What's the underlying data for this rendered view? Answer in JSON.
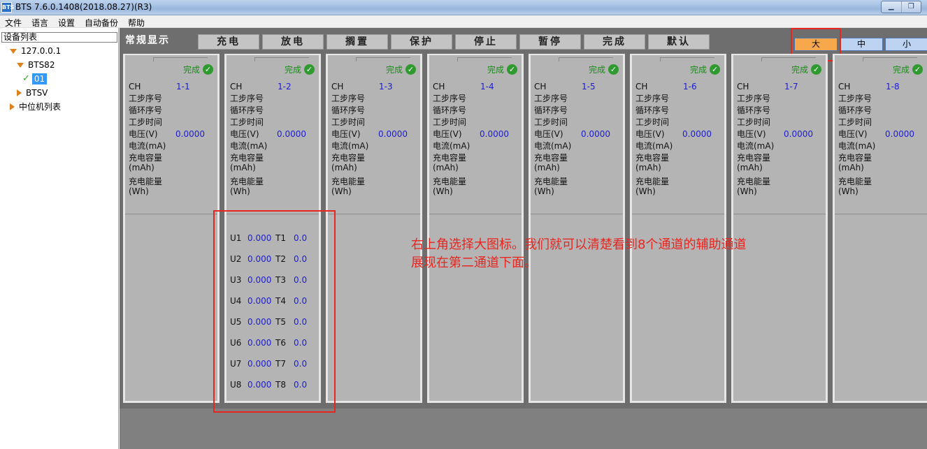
{
  "window": {
    "title": "BTS 7.6.0.1408(2018.08.27)(R3)",
    "icon_text": "BTS"
  },
  "menu": [
    "文件",
    "语言",
    "设置",
    "自动备份",
    "帮助"
  ],
  "sidebar": {
    "header": "设备列表",
    "tree": [
      {
        "label": "127.0.0.1",
        "expanded": true
      },
      {
        "label": "BTS82",
        "expanded": true
      },
      {
        "label": "01",
        "selected": true,
        "status": "checked"
      },
      {
        "label": "BTSV",
        "expanded": false
      },
      {
        "label": "中位机列表",
        "expanded": false
      }
    ]
  },
  "toolbar": {
    "general_label": "常规显示",
    "tabs": [
      "充电",
      "放电",
      "搁置",
      "保护",
      "停止",
      "暂停",
      "完成",
      "默认"
    ],
    "size_buttons": {
      "large": "大",
      "medium": "中",
      "small": "小"
    },
    "selected_size": "large"
  },
  "field_labels": {
    "ch": "CH",
    "step_no": "工步序号",
    "cycle_no": "循环序号",
    "step_time": "工步时间",
    "voltage": "电压(V)",
    "current": "电流(mA)",
    "charge_capacity_1": "充电容量",
    "charge_capacity_2": "(mAh)",
    "charge_energy_1": "充电能量",
    "charge_energy_2": "(Wh)"
  },
  "channels": [
    {
      "id": "1-1",
      "status": "完成",
      "voltage": "0.0000"
    },
    {
      "id": "1-2",
      "status": "完成",
      "voltage": "0.0000"
    },
    {
      "id": "1-3",
      "status": "完成",
      "voltage": "0.0000"
    },
    {
      "id": "1-4",
      "status": "完成",
      "voltage": "0.0000"
    },
    {
      "id": "1-5",
      "status": "完成",
      "voltage": "0.0000"
    },
    {
      "id": "1-6",
      "status": "完成",
      "voltage": "0.0000"
    },
    {
      "id": "1-7",
      "status": "完成",
      "voltage": "0.0000"
    },
    {
      "id": "1-8",
      "status": "完成",
      "voltage": "0.0000"
    }
  ],
  "aux_channels": [
    {
      "u": "U1",
      "u_val": "0.000",
      "t": "T1",
      "t_val": "0.0"
    },
    {
      "u": "U2",
      "u_val": "0.000",
      "t": "T2",
      "t_val": "0.0"
    },
    {
      "u": "U3",
      "u_val": "0.000",
      "t": "T3",
      "t_val": "0.0"
    },
    {
      "u": "U4",
      "u_val": "0.000",
      "t": "T4",
      "t_val": "0.0"
    },
    {
      "u": "U5",
      "u_val": "0.000",
      "t": "T5",
      "t_val": "0.0"
    },
    {
      "u": "U6",
      "u_val": "0.000",
      "t": "T6",
      "t_val": "0.0"
    },
    {
      "u": "U7",
      "u_val": "0.000",
      "t": "T7",
      "t_val": "0.0"
    },
    {
      "u": "U8",
      "u_val": "0.000",
      "t": "T8",
      "t_val": "0.0"
    }
  ],
  "annotation": {
    "line1": "右上角选择大图标。我们就可以清楚看到8个通道的辅助通道",
    "line2": "展现在第二通道下面。",
    "color": "#e8261f"
  },
  "colors": {
    "selected_size": "#f7a84c",
    "status_ok": "#2f9a2f",
    "value_text": "#1c1cd8"
  }
}
